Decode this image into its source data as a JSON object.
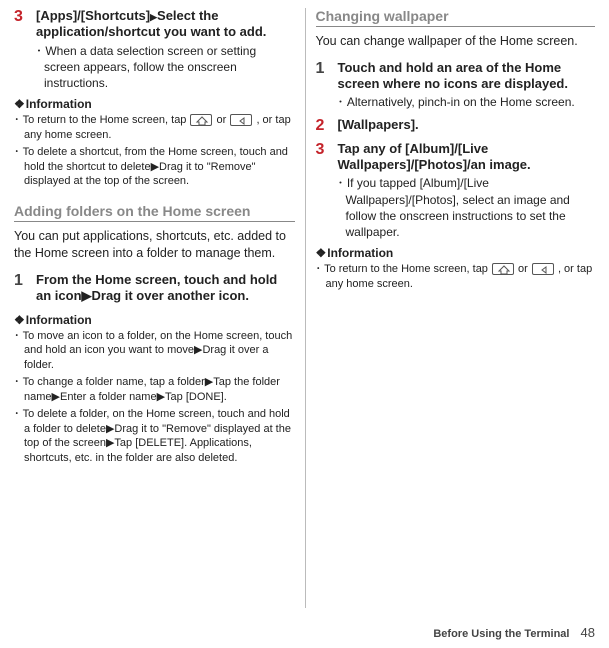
{
  "left": {
    "step3": {
      "num": "3",
      "title_prefix": "[Apps]/[Shortcuts]",
      "title_rest": "Select the application/shortcut you want to add.",
      "sub": "When a data selection screen or setting screen appears, follow the onscreen instructions."
    },
    "info1_head": "Information",
    "info1_items": [
      "To return to the Home screen, tap HOME or BACK, or tap any home screen.",
      "To delete a shortcut, from the Home screen, touch and hold the shortcut to delete▶Drag it to \"Remove\" displayed at the top of the screen."
    ],
    "section1_head": "Adding folders on the Home screen",
    "section1_intro": "You can put applications, shortcuts, etc. added to the Home screen into a folder to manage them.",
    "step1": {
      "num": "1",
      "title": "From the Home screen, touch and hold an icon▶Drag it over another icon."
    },
    "info2_head": "Information",
    "info2_items": [
      "To move an icon to a folder, on the Home screen, touch and hold an icon you want to move▶Drag it over a folder.",
      "To change a folder name, tap a folder▶Tap the folder name▶Enter a folder name▶Tap [DONE].",
      "To delete a folder, on the Home screen, touch and hold a folder to delete▶Drag it to \"Remove\" displayed at the top of the screen▶Tap [DELETE]. Applications, shortcuts, etc. in the folder are also deleted."
    ]
  },
  "right": {
    "section_head": "Changing wallpaper",
    "section_intro": "You can change wallpaper of the Home screen.",
    "step1": {
      "num": "1",
      "title": "Touch and hold an area of the Home screen where no icons are displayed.",
      "sub": "Alternatively, pinch-in on the Home screen."
    },
    "step2": {
      "num": "2",
      "title": "[Wallpapers]."
    },
    "step3": {
      "num": "3",
      "title": "Tap any of [Album]/[Live Wallpapers]/[Photos]/an image.",
      "sub": "If you tapped [Album]/[Live Wallpapers]/[Photos], select an image and follow the onscreen instructions to set the wallpaper."
    },
    "info_head": "Information",
    "info_items": [
      "To return to the Home screen, tap HOME or BACK, or tap any home screen."
    ]
  },
  "footer": {
    "label": "Before Using the Terminal",
    "page": "48"
  }
}
